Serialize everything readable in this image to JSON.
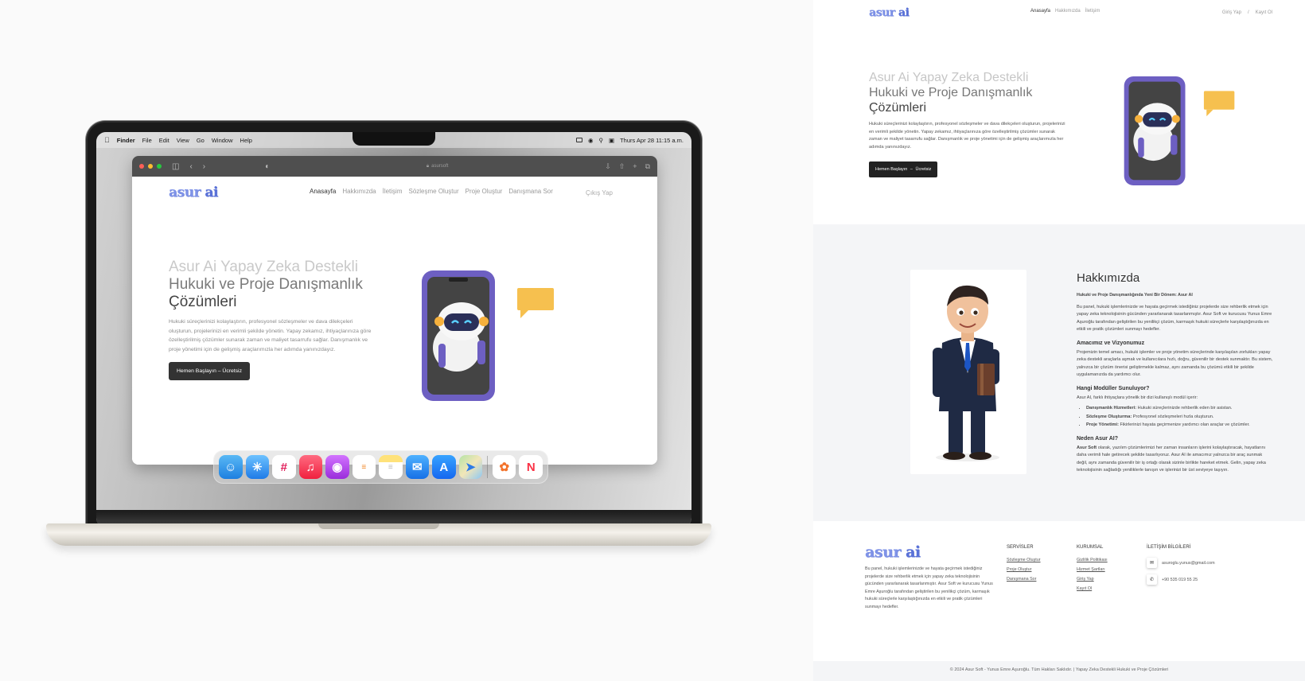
{
  "mac": {
    "menubar": {
      "app": "Finder",
      "items": [
        "File",
        "Edit",
        "View",
        "Go",
        "Window",
        "Help"
      ],
      "clock": "Thurs Apr 28 11:15 a.m."
    },
    "browser_url": "asursoft",
    "dock_apps": [
      "finder-icon",
      "safari-icon",
      "slack-icon",
      "music-icon",
      "podcasts-icon",
      "reminders-icon",
      "notes-icon",
      "mail-icon",
      "app-store-icon",
      "maps-icon",
      "photos-icon",
      "news-icon"
    ]
  },
  "brand": {
    "logo_main": "asur",
    "logo_ai": "ai",
    "accent": "#7f93e8"
  },
  "laptop_site": {
    "nav": [
      "Anasayfa",
      "Hakkımızda",
      "İletişim",
      "Sözleşme Oluştur",
      "Proje Oluştur",
      "Danışmana Sor"
    ],
    "logout": "Çıkış Yap",
    "hero_line1": "Asur Ai Yapay Zeka Destekli",
    "hero_line2": "Hukuki ve Proje Danışmanlık",
    "hero_line3": "Çözümleri",
    "hero_text": "Hukuki süreçlerinizi kolaylaştırın, profesyonel sözleşmeler ve dava dilekçeleri oluşturun, projelerinizi en verimli şekilde yönetin. Yapay zekamız, ihtiyaçlarınıza göre özelleştirilmiş çözümler sunarak zaman ve maliyet tasarrufu sağlar. Danışmanlık ve proje yönetimi için de gelişmiş araçlarımızla her adımda yanınızdayız.",
    "cta": "Hemen Başlayın – Ücretsiz"
  },
  "page": {
    "nav": [
      "Anasayfa",
      "Hakkımızda",
      "İletişim"
    ],
    "login": "Giriş Yap",
    "sep": "/",
    "register": "Kayıt Ol",
    "hero_line1": "Asur Ai Yapay Zeka Destekli",
    "hero_line2": "Hukuki ve Proje Danışmanlık",
    "hero_line3": "Çözümleri",
    "hero_text": "Hukuki süreçlerinizi kolaylaştırın, profesyonel sözleşmeler ve dava dilekçeleri oluşturun, projelerinizi en verimli şekilde yönetin. Yapay zekamız, ihtiyaçlarınıza göre özelleştirilmiş çözümler sunarak zaman ve maliyet tasarrufu sağlar. Danışmanlık ve proje yönetimi için de gelişmiş araçlarımızla her adımda yanınızdayız.",
    "cta_a": "Hemen Başlayın",
    "cta_b": "Ücretsiz",
    "about": {
      "title": "Hakkımızda",
      "subtitle": "Hukuki ve Proje Danışmanlığında Yeni Bir Dönem: Asur AI",
      "intro": "Bu panel, hukuki işlemlerinizde ve hayata geçirmek istediğiniz projelerde size rehberlik etmek için yapay zeka teknolojisinin gücünden yararlanarak tasarlanmıştır. Asur Soft ve kurucusu Yunus Emre Aşuroğlu tarafından geliştirilen bu yenilikçi çözüm, karmaşık hukuki süreçlerle karşılaştığınızda en etkili ve pratik çözümleri sunmayı hedefler.",
      "h_vision": "Amacımız ve Vizyonumuz",
      "vision": "Projemizin temel amacı, hukuki işlemler ve proje yönetim süreçlerinde karşılaşılan zorlukları yapay zeka destekli araçlarla aşmak ve kullanıcılara hızlı, doğru, güvenilir bir destek sunmaktır. Bu sistem, yalnızca bir çözüm önerisi geliştirmekle kalmaz, aynı zamanda bu çözümü etkili bir şekilde uygulamanızda da yardımcı olur.",
      "h_modules": "Hangi Modüller Sunuluyor?",
      "modules_intro": "Asur AI, farklı ihtiyaçlara yönelik bir dizi kullanışlı modül içerir:",
      "modules": [
        {
          "name": "Danışmanlık Hizmetleri:",
          "desc": " Hukuki süreçlerinizde rehberlik eden bir asistan."
        },
        {
          "name": "Sözleşme Oluşturma:",
          "desc": " Profesyonel sözleşmeleri hızla oluşturun."
        },
        {
          "name": "Proje Yönetimi:",
          "desc": " Fikirlerinizi hayata geçirmenize yardımcı olan araçlar ve çözümler."
        }
      ],
      "h_why": "Neden Asur AI?",
      "why_bold": "Asur Soft",
      "why": " olarak, yazılım çözümlerimizi her zaman insanların işlerini kolaylaştıracak, hayatlarını daha verimli hale getirecek şekilde tasarlıyoruz. Asur AI ile amacımız yalnızca bir araç sunmak değil, aynı zamanda güvenilir bir iş ortağı olarak sizinle birlikte hareket etmek. Gelin, yapay zeka teknolojisinin sağladığı yeniliklerle tanışın ve işlerinizi bir üst seviyeye taşıyın."
    },
    "footer": {
      "text": "Bu panel, hukuki işlemlerinizde ve hayata geçirmek istediğiniz projelerde size rehberlik etmek için yapay zeka teknolojisinin gücünden yararlanarak tasarlanmıştır. Asur Soft ve kurucusu Yunus Emre Aşuroğlu tarafından geliştirilen bu yenilikçi çözüm, karmaşık hukuki süreçlerle karşılaştığınızda en etkili ve pratik çözümleri sunmayı hedefler.",
      "services_title": "SERVİSLER",
      "services": [
        "Sözleşme Oluştur",
        "Proje Oluştur",
        "Danışmana Sor"
      ],
      "corporate_title": "KURUMSAL",
      "corporate": [
        "Gizlilik Politikası",
        "Hizmet Şartları",
        "Giriş Yap",
        "Kayıt Ol"
      ],
      "contact_title": "İLETİŞİM BİLGİLERİ",
      "email": "asuroglu.yunus@gmail.com",
      "phone": "+90 535 019 55 25"
    },
    "copyright": "© 2024 Asur Soft - Yunus Emre Aşuroğlu. Tüm Hakları Saklıdır. | Yapay Zeka Destekli Hukuki ve Proje Çözümleri"
  }
}
